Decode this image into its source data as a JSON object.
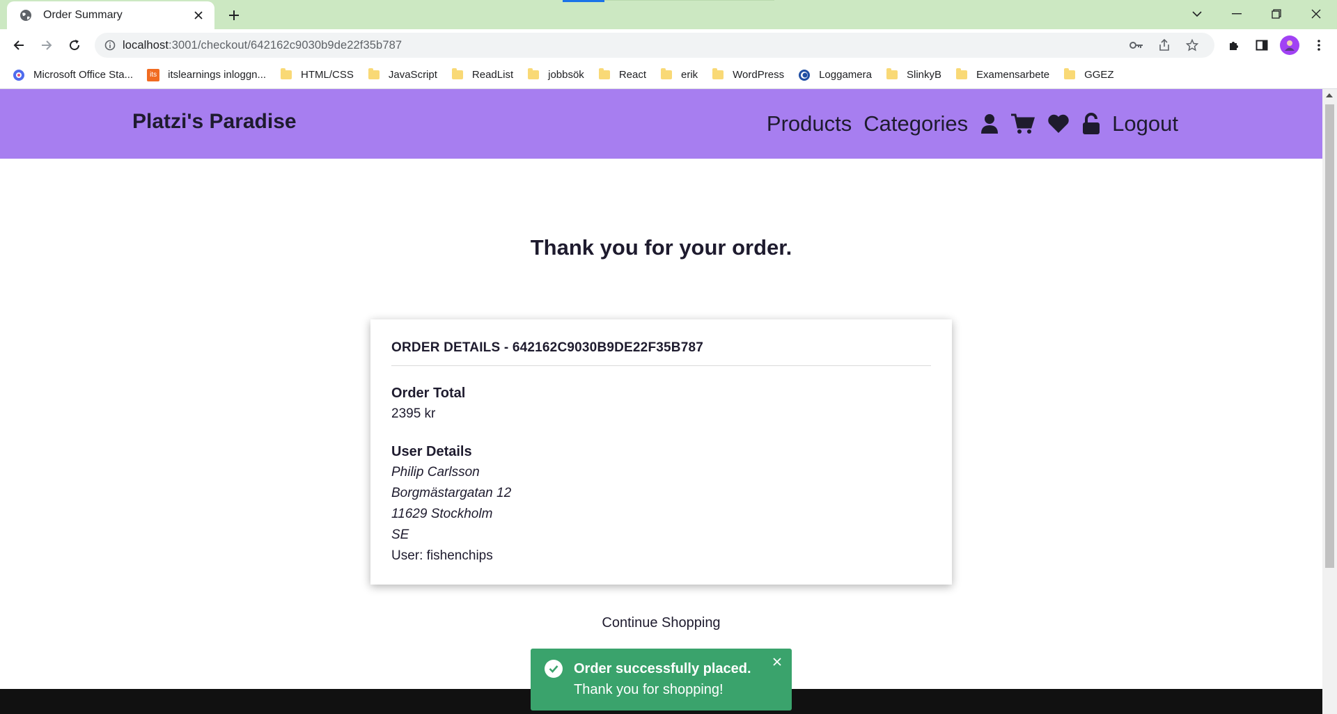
{
  "browser": {
    "tab_title": "Order Summary",
    "url_host": "localhost",
    "url_path": ":3001/checkout/642162c9030b9de22f35b787",
    "bookmarks": [
      {
        "label": "Microsoft Office Sta...",
        "icon": "office-icon"
      },
      {
        "label": "itslearnings inloggn...",
        "icon": "its-icon"
      },
      {
        "label": "HTML/CSS",
        "icon": "folder-icon"
      },
      {
        "label": "JavaScript",
        "icon": "folder-icon"
      },
      {
        "label": "ReadList",
        "icon": "folder-icon"
      },
      {
        "label": "jobbsök",
        "icon": "folder-icon"
      },
      {
        "label": "React",
        "icon": "folder-icon"
      },
      {
        "label": "erik",
        "icon": "folder-icon"
      },
      {
        "label": "WordPress",
        "icon": "folder-icon"
      },
      {
        "label": "Loggamera",
        "icon": "loggamera-icon"
      },
      {
        "label": "SlinkyB",
        "icon": "folder-icon"
      },
      {
        "label": "Examensarbete",
        "icon": "folder-icon"
      },
      {
        "label": "GGEZ",
        "icon": "folder-icon"
      }
    ],
    "its_badge": "its"
  },
  "header": {
    "brand": "Platzi's Paradise",
    "nav": {
      "products": "Products",
      "categories": "Categories",
      "logout": "Logout"
    },
    "color": "#a77ef0"
  },
  "main": {
    "heading": "Thank you for your order.",
    "order": {
      "title": "ORDER DETAILS - 642162C9030B9DE22F35B787",
      "total_label": "Order Total",
      "total_value": "2395 kr",
      "user_label": "User Details",
      "name": "Philip Carlsson",
      "street": "Borgmästargatan 12",
      "city": "11629 Stockholm",
      "country": "SE",
      "user": "User: fishenchips"
    },
    "continue_link": "Continue Shopping"
  },
  "toast": {
    "title": "Order successfully placed.",
    "message": "Thank you for shopping!",
    "color": "#3aa36c"
  }
}
